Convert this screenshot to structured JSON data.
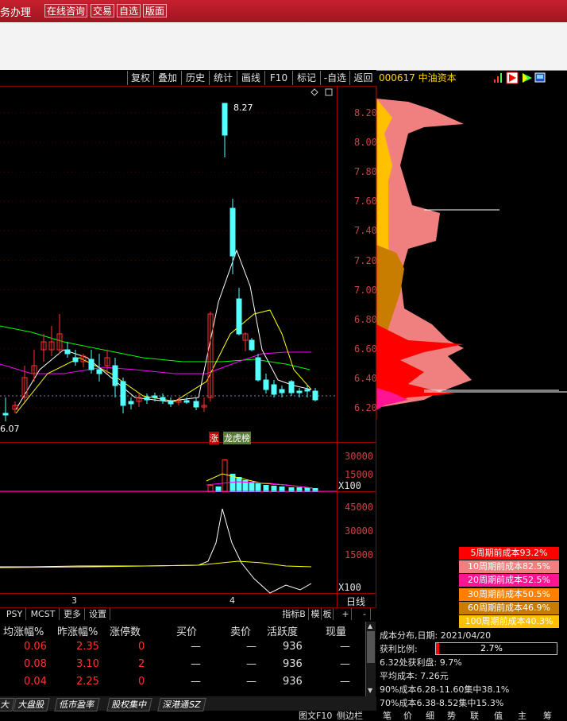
{
  "topbar": {
    "title": "务办理",
    "buttons": [
      "在线咨询",
      "交易",
      "自选",
      "版面"
    ]
  },
  "toolbar": {
    "items": [
      "复权",
      "叠加",
      "历史",
      "统计",
      "画线",
      "F10",
      "标记",
      "-自选",
      "返回"
    ]
  },
  "stock": {
    "code_name": "000617 中油资本"
  },
  "price_axis": {
    "ticks": [
      "8.20",
      "8.00",
      "7.80",
      "7.60",
      "7.40",
      "7.20",
      "7.00",
      "6.80",
      "6.60",
      "6.40",
      "6.20"
    ],
    "high_label": "8.27",
    "low_label": "6.07"
  },
  "tags": {
    "zhang": "涨",
    "longhu": "龙虎榜"
  },
  "volume_axis": {
    "ticks": [
      "30000",
      "15000"
    ],
    "unit": "X100"
  },
  "indicator_axis": {
    "ticks": [
      "45000",
      "30000",
      "15000"
    ],
    "unit": "X100"
  },
  "time_axis": {
    "labels": [
      "3",
      "4"
    ],
    "period": "日线"
  },
  "bottom_controls": {
    "tabs": [
      "PSY",
      "MCST",
      "更多",
      "设置"
    ],
    "right": [
      "指标B",
      "模",
      "板",
      "+",
      "-"
    ]
  },
  "cost_legend": [
    {
      "label": "5周期前成本93.2%",
      "color": "#ff0000"
    },
    {
      "label": "10周期前成本82.5%",
      "color": "#f08080"
    },
    {
      "label": "20周期前成本52.5%",
      "color": "#ff1493"
    },
    {
      "label": "30周期前成本50.5%",
      "color": "#ff7f00"
    },
    {
      "label": "60周期前成本46.9%",
      "color": "#c87c00"
    },
    {
      "label": "100周期前成本40.3%",
      "color": "#ffc000"
    }
  ],
  "cost_info": {
    "date_line": "成本分布,日期: 2021/04/20",
    "profit_label": "获利比例:",
    "profit_value": "2.7%",
    "profit_fraction": 0.027,
    "profit_chip": "6.32处获利盘: 9.7%",
    "avg_cost": "平均成本: 7.26元",
    "cost90": "90%成本6.28-11.60集中38.1%",
    "cost70": "70%成本6.38-8.52集中15.3%"
  },
  "table": {
    "headers": [
      "均涨幅%",
      "昨涨幅%",
      "涨停数",
      "买价",
      "卖价",
      "活跃度",
      "现量"
    ],
    "rows": [
      [
        "0.06",
        "2.35",
        "0",
        "—",
        "—",
        "936",
        "—"
      ],
      [
        "0.08",
        "3.10",
        "2",
        "—",
        "—",
        "936",
        "—"
      ],
      [
        "0.04",
        "2.25",
        "0",
        "—",
        "—",
        "936",
        "—"
      ]
    ]
  },
  "bottom_tabs": [
    "大",
    "大盘股",
    "低市盈率",
    "股权集中",
    "深港通SZ"
  ],
  "right_bottom_tabs": [
    "图文F10",
    "侧边栏",
    "笔",
    "价",
    "细",
    "势",
    "联",
    "值",
    "主",
    "筹"
  ],
  "colors": {
    "up": "#ff3232",
    "down": "#54ffff",
    "ma5": "#ffffff",
    "ma10": "#ffff00",
    "ma20": "#ff00ff",
    "ma60": "#00ff00"
  }
}
